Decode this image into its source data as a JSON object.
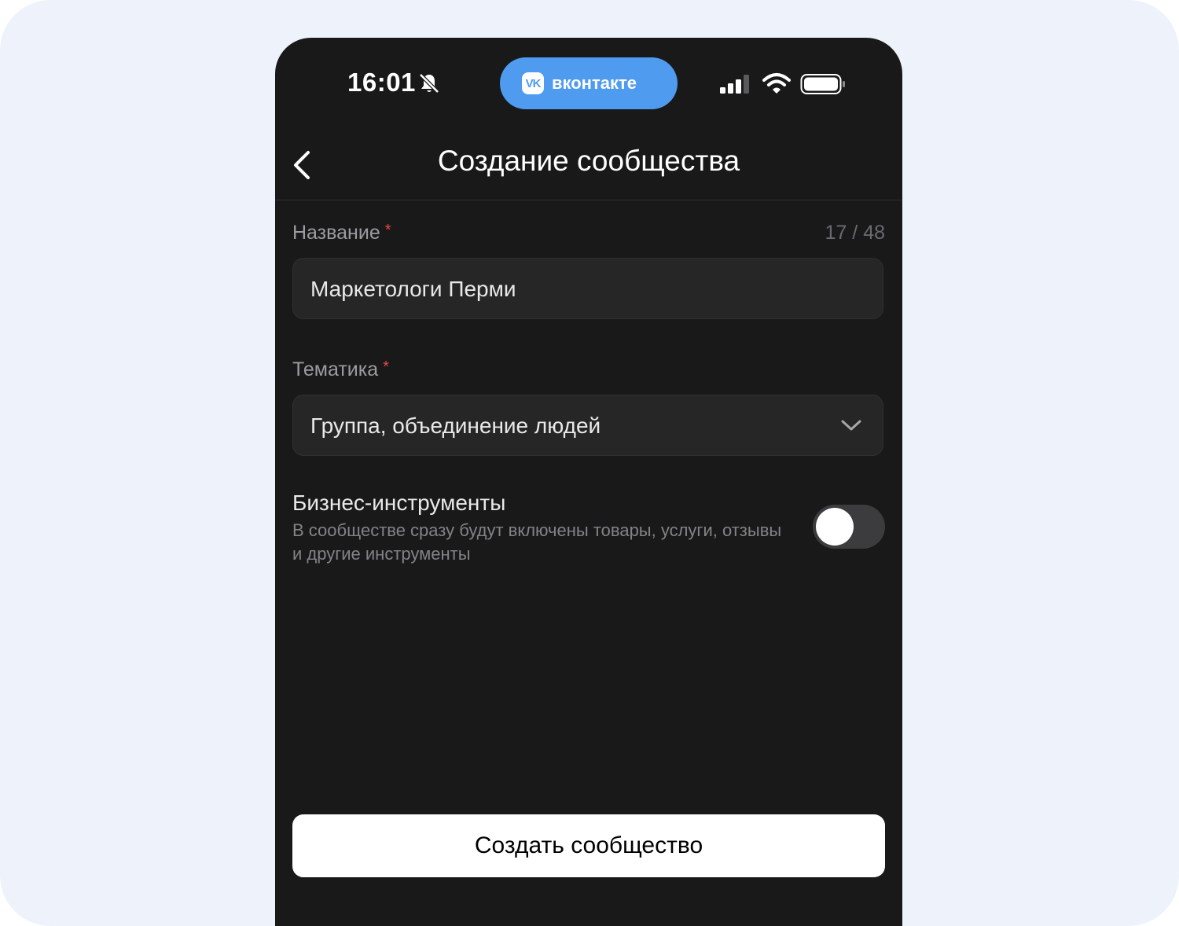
{
  "status_bar": {
    "time": "16:01",
    "bell_icon": "bell-muted-icon",
    "signal_icon": "cellular-signal-icon",
    "wifi_icon": "wifi-icon",
    "battery_icon": "battery-icon"
  },
  "app_pill": {
    "logo_text": "VK",
    "label": "вконтакте",
    "color": "#4f9bf0"
  },
  "header": {
    "back_icon": "chevron-left-icon",
    "title": "Создание сообщества"
  },
  "form": {
    "name": {
      "label": "Название",
      "required_mark": "*",
      "counter": "17 / 48",
      "value": "Маркетологи Перми"
    },
    "topic": {
      "label": "Тематика",
      "required_mark": "*",
      "value": "Группа, объединение людей",
      "dropdown_icon": "chevron-down-icon"
    },
    "business_tools": {
      "title": "Бизнес-инструменты",
      "description": "В сообществе сразу будут включены товары, услуги, отзывы и другие инструменты",
      "enabled": false
    }
  },
  "footer": {
    "create_label": "Создать сообщество"
  },
  "colors": {
    "background": "#19191a",
    "required": "#e64646",
    "page_background": "#eef3fb"
  }
}
